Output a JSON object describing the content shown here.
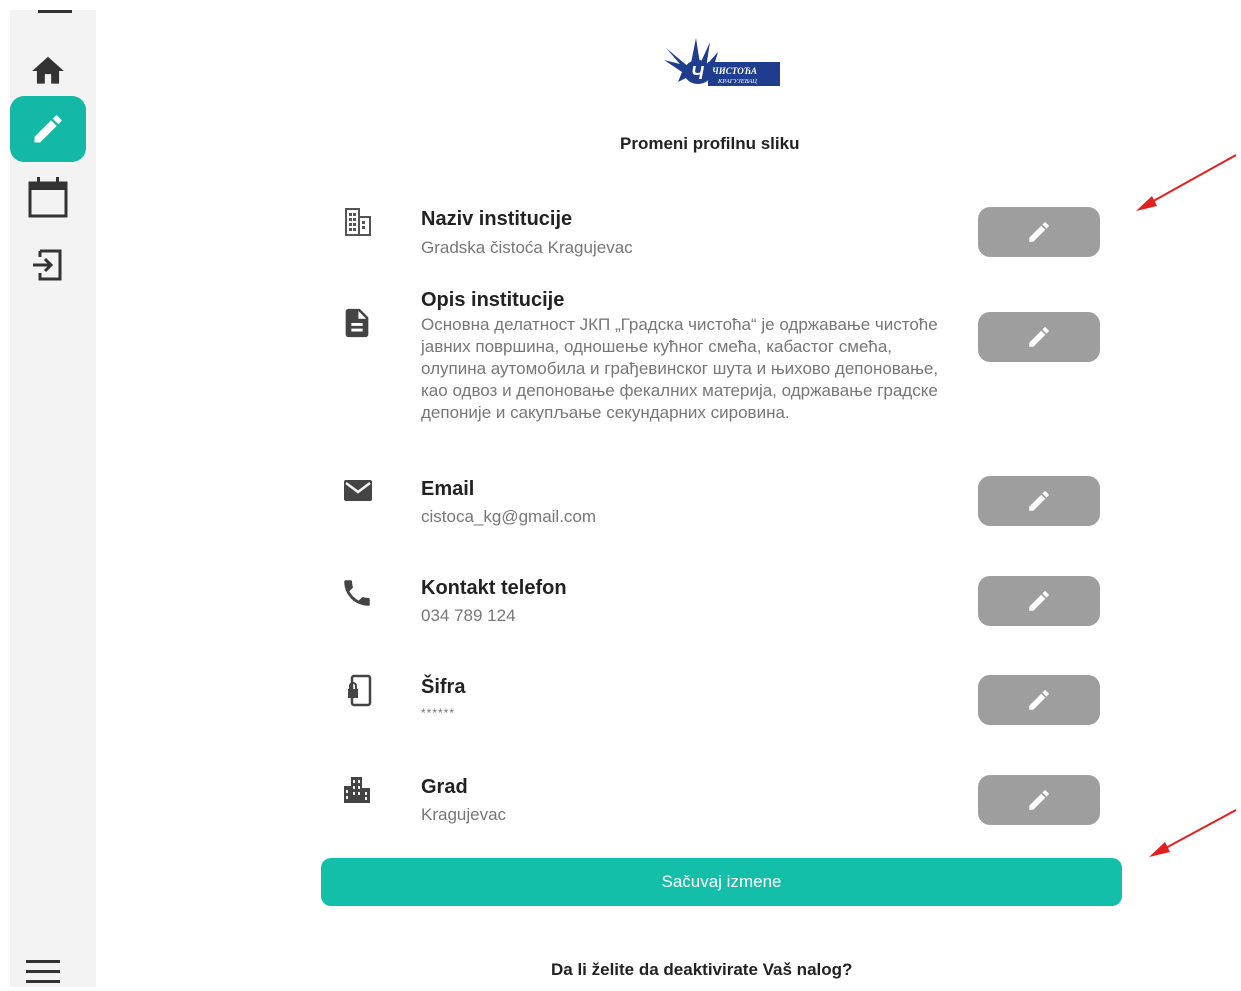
{
  "sidebar": {
    "items": [
      {
        "icon": "home-icon"
      },
      {
        "icon": "pencil-icon",
        "active": true
      },
      {
        "icon": "calendar-icon"
      },
      {
        "icon": "logout-icon"
      }
    ],
    "menu_icon": "hamburger-icon",
    "accent_color": "#14b8a6"
  },
  "logo": {
    "line1": "ЧИСТОЋА",
    "line2": "КРАГУЈЕВАЦ"
  },
  "profile": {
    "change_photo_label": "Promeni profilnu sliku",
    "fields": [
      {
        "label": "Naziv institucije",
        "value": "Gradska čistoća Kragujevac",
        "icon": "building-icon"
      },
      {
        "label": "Opis institucije",
        "value": "Основна делатност ЈКП „Градска чистоћа“ је одржавање чистоће јавних површина, одношење кућног смећа, кабастог смећа, олупина аутомобила и грађевинског шута и њихово депоновање, као одвоз и депоновање фекалних материја, одржавање градске депоније и сакупљање секундарних сировина.",
        "icon": "document-icon"
      },
      {
        "label": "Email",
        "value": "cistoca_kg@gmail.com",
        "icon": "email-icon"
      },
      {
        "label": "Kontakt telefon",
        "value": "034 789 124",
        "icon": "phone-icon"
      },
      {
        "label": "Šifra",
        "value": "******",
        "icon": "lock-phone-icon"
      },
      {
        "label": "Grad",
        "value": "Kragujevac",
        "icon": "city-icon"
      }
    ]
  },
  "actions": {
    "save_label": "Sačuvaj izmene",
    "deactivate_question": "Da li želite da deaktivirate Vaš nalog?"
  },
  "colors": {
    "edit_button": "#9e9e9e",
    "save_button": "#14bfa9",
    "annotation_arrow": "#e32020"
  }
}
